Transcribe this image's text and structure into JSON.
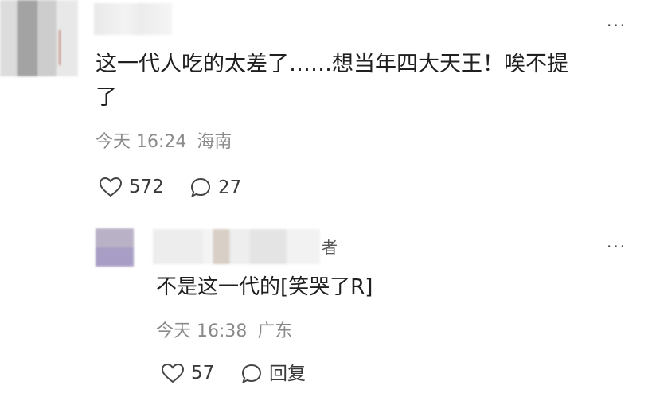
{
  "main_comment": {
    "text_line1": "这一代人吃的太差了……想当年四大天王！唉不提",
    "text_line2": "了",
    "time": "今天 16:24",
    "location": "海南",
    "likes": "572",
    "replies": "27",
    "more_label": "···"
  },
  "reply_comment": {
    "badge": "者",
    "text": "不是这一代的[笑哭了R]",
    "time": "今天 16:38",
    "location": "广东",
    "likes": "57",
    "reply_label": "回复",
    "more_label": "···"
  },
  "icons": {
    "like": "heart-icon",
    "comment": "comment-bubble-icon",
    "more": "more-dots-icon"
  },
  "colors": {
    "meta": "#8a8a8a",
    "text": "#1f1f1f"
  }
}
